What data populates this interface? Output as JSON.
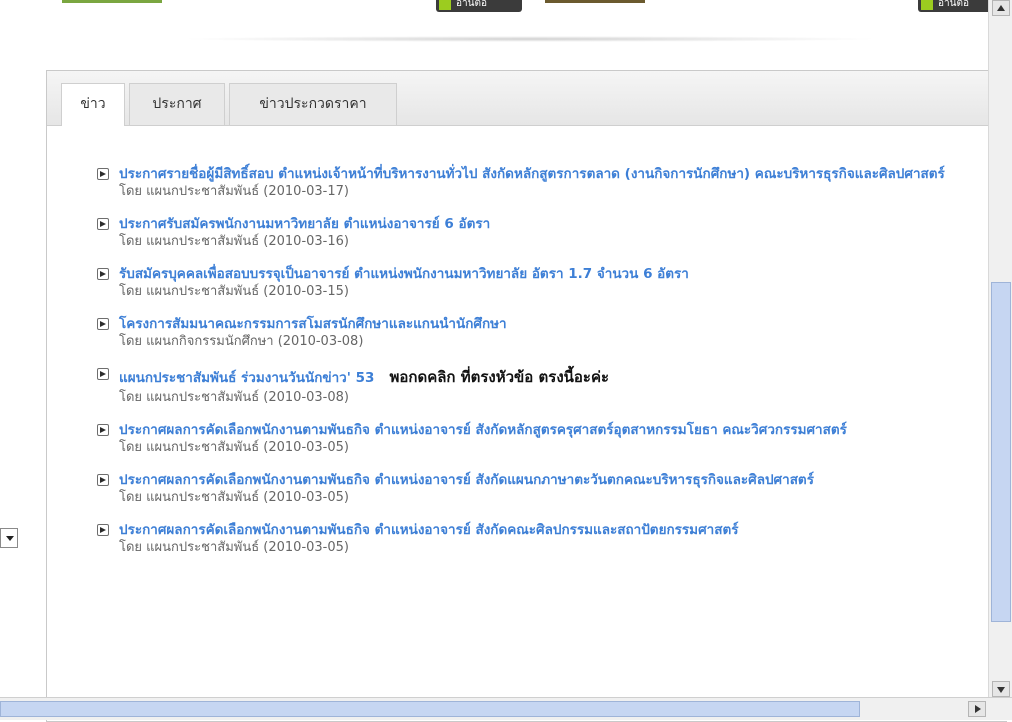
{
  "top": {
    "read_left": "อ่านต่อ",
    "read_right": "อ่านต่อ"
  },
  "tabs": [
    {
      "label": "ข่าว",
      "active": true
    },
    {
      "label": "ประกาศ",
      "active": false
    },
    {
      "label": "ข่าวประกวดราคา",
      "active": false
    }
  ],
  "news": [
    {
      "title": "ประกาศรายชื่อผู้มีสิทธิ์สอบ ตำแหน่งเจ้าหน้าที่บริหารงานทั่วไป สังกัดหลักสูตรการตลาด (งานกิจการนักศึกษา) คณะบริหารธุรกิจและศิลปศาสตร์",
      "meta": "โดย แผนกประชาสัมพันธ์ (2010-03-17)"
    },
    {
      "title": "ประกาศรับสมัครพนักงานมหาวิทยาลัย ตำแหน่งอาจารย์ 6 อัตรา",
      "meta": "โดย แผนกประชาสัมพันธ์ (2010-03-16)"
    },
    {
      "title": "รับสมัครบุคคลเพื่อสอบบรรจุเป็นอาจารย์ ตำแหน่งพนักงานมหาวิทยาลัย อัตรา 1.7 จำนวน 6 อัตรา",
      "meta": "โดย แผนกประชาสัมพันธ์ (2010-03-15)"
    },
    {
      "title": "โครงการสัมมนาคณะกรรมการสโมสรนักศึกษาและแกนนำนักศึกษา",
      "meta": "โดย แผนกกิจกรรมนักศึกษา (2010-03-08)"
    },
    {
      "title": "แผนกประชาสัมพันธ์ ร่วมงานวันนักข่าว' 53",
      "meta": "โดย แผนกประชาสัมพันธ์ (2010-03-08)",
      "annotation": "พอกดคลิก ที่ตรงหัวข้อ ตรงนี้อะค่ะ"
    },
    {
      "title": "ประกาศผลการคัดเลือกพนักงานตามพันธกิจ ตำแหน่งอาจารย์ สังกัดหลักสูตรครุศาสตร์อุตสาหกรรมโยธา คณะวิศวกรรมศาสตร์",
      "meta": "โดย แผนกประชาสัมพันธ์ (2010-03-05)"
    },
    {
      "title": "ประกาศผลการคัดเลือกพนักงานตามพันธกิจ ตำแหน่งอาจารย์ สังกัดแผนกภาษาตะวันตกคณะบริหารธุรกิจและศิลปศาสตร์",
      "meta": "โดย แผนกประชาสัมพันธ์ (2010-03-05)"
    },
    {
      "title": "ประกาศผลการคัดเลือกพนักงานตามพันธกิจ ตำแหน่งอาจารย์ สังกัดคณะศิลปกรรมและสถาปัตยกรรมศาสตร์",
      "meta": "โดย แผนกประชาสัมพันธ์ (2010-03-05)"
    }
  ],
  "colors": {
    "link": "#3d7fd6",
    "scroll_thumb": "#c6d6f2"
  }
}
